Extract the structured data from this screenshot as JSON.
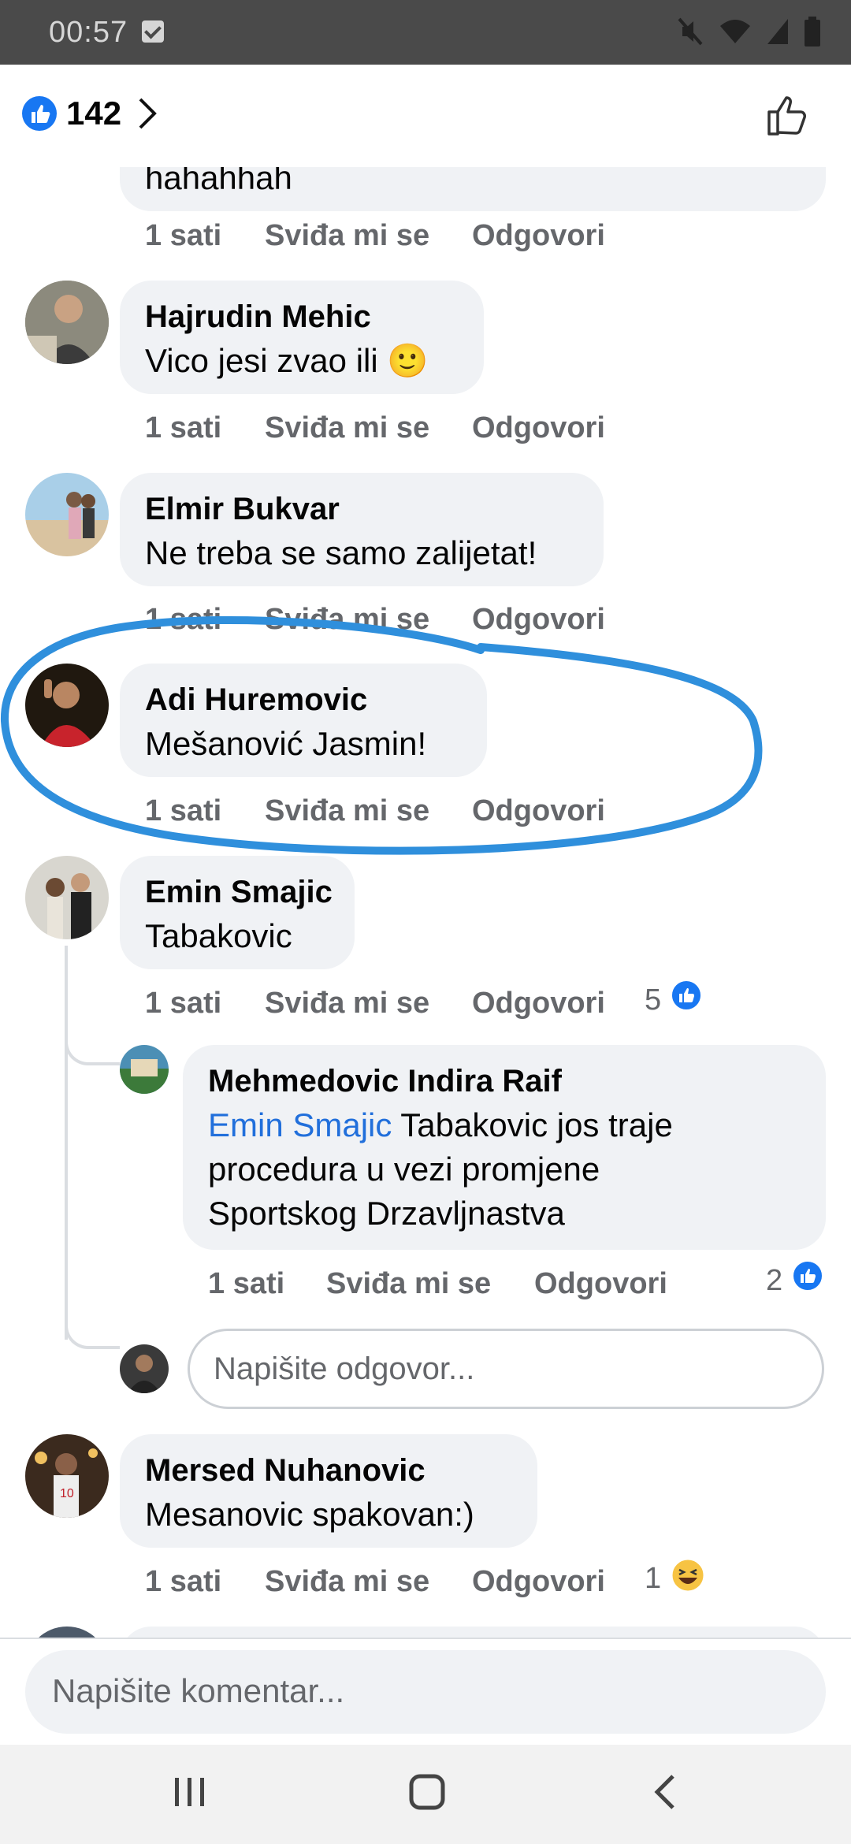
{
  "status_bar": {
    "time": "00:57"
  },
  "header": {
    "reaction_count": "142"
  },
  "partial_comment": {
    "text": "hahahhah"
  },
  "comments": [
    {
      "name": "Hajrudin Mehic",
      "text": "Vico jesi zvao ili 🙂",
      "time": "1 sati",
      "like": "Sviđa mi se",
      "reply": "Odgovori"
    },
    {
      "name": "Elmir Bukvar",
      "text": "Ne treba se samo zalijetat!",
      "time": "1 sati",
      "like": "Sviđa mi se",
      "reply": "Odgovori"
    },
    {
      "name": "Adi Huremovic",
      "text": "Mešanović Jasmin!",
      "time": "1 sati",
      "like": "Sviđa mi se",
      "reply": "Odgovori"
    },
    {
      "name": "Emin Smajic",
      "text": "Tabakovic",
      "time": "1 sati",
      "like": "Sviđa mi se",
      "reply": "Odgovori",
      "reactions": "5"
    },
    {
      "name": "Mersed Nuhanovic",
      "text": "Mesanovic spakovan:)",
      "time": "1 sati",
      "like": "Sviđa mi se",
      "reply": "Odgovori",
      "reactions": "1"
    }
  ],
  "partial_actions": {
    "time": "1 sati",
    "like": "Sviđa mi se",
    "reply": "Odgovori"
  },
  "reply": {
    "name": "Mehmedovic Indira Raif",
    "mention": "Emin Smajic",
    "line1": " Tabakovic jos traje",
    "line2": "procedura u vezi promjene",
    "line3": "Sportskog Drzavljnastva",
    "time": "1 sati",
    "like": "Sviđa mi se",
    "reply": "Odgovori",
    "reactions": "2"
  },
  "reply_input": {
    "placeholder": "Napišite odgovor..."
  },
  "composer": {
    "placeholder": "Napišite komentar..."
  },
  "icons": [
    "mute-icon",
    "wifi-icon",
    "signal-icon",
    "battery-icon",
    "like-icon",
    "chevron-right-icon",
    "recent-apps-icon",
    "home-icon",
    "back-icon",
    "haha-icon"
  ],
  "colors": {
    "accent": "#1877f2",
    "highlight_ink": "#2f8fdc",
    "bubble": "#f0f2f5"
  }
}
